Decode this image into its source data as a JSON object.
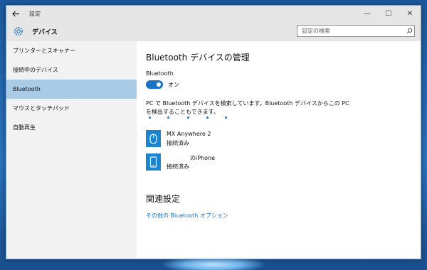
{
  "window": {
    "title": "設定",
    "back_icon": "back-arrow-icon",
    "controls": {
      "minimize": "—",
      "maximize": "☐",
      "close": "✕"
    }
  },
  "header": {
    "section_icon": "gear-icon",
    "section_title": "デバイス",
    "search_placeholder": "設定の検索"
  },
  "sidebar": {
    "items": [
      {
        "label": "プリンターとスキャナー",
        "active": false
      },
      {
        "label": "接続中のデバイス",
        "active": false
      },
      {
        "label": "Bluetooth",
        "active": true
      },
      {
        "label": "マウスとタッチパッド",
        "active": false
      },
      {
        "label": "自動再生",
        "active": false
      }
    ]
  },
  "main": {
    "title": "Bluetooth デバイスの管理",
    "bluetooth_label": "Bluetooth",
    "toggle_state": "オン",
    "description_line1": "PC で Bluetooth デバイスを検索しています。Bluetooth デバイスからこの PC",
    "description_line2": "を検出することもできます。",
    "devices": [
      {
        "name": "MX Anywhere 2",
        "status": "接続済み",
        "icon": "mouse-icon"
      },
      {
        "name": "のiPhone",
        "status": "接続済み",
        "icon": "phone-icon"
      }
    ],
    "related_title": "関連設定",
    "related_link": "その他の Bluetooth オプション"
  },
  "colors": {
    "accent": "#1b73c6",
    "sidebar_active": "#a9cbe6",
    "titlebar": "#e6e6e6",
    "sidebar_bg": "#f2f2f2"
  }
}
